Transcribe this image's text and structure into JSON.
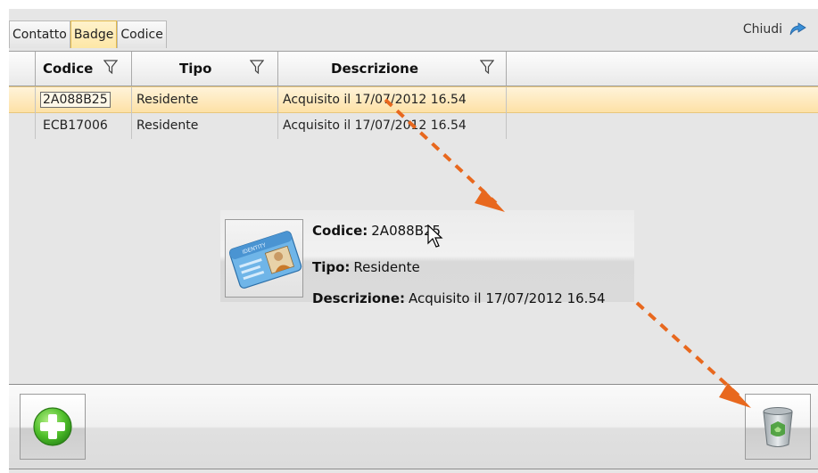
{
  "tabs": [
    "Contatto",
    "Badge",
    "Codice"
  ],
  "active_tab": "Badge",
  "close_label": "Chiudi",
  "columns": [
    {
      "label": "Codice",
      "filter_icon": "filter-icon"
    },
    {
      "label": "Tipo",
      "filter_icon": "filter-icon"
    },
    {
      "label": "Descrizione",
      "filter_icon": "filter-icon"
    }
  ],
  "rows": [
    {
      "codice": "2A088B25",
      "tipo": "Residente",
      "descrizione": "Acquisito il 17/07/2012 16.54",
      "selected": true
    },
    {
      "codice": "ECB17006",
      "tipo": "Residente",
      "descrizione": "Acquisito il 17/07/2012 16.54",
      "selected": false
    }
  ],
  "tooltip": {
    "image": "identity-card-icon",
    "codice_label": "Codice:",
    "codice_value": "2A088B25",
    "tipo_label": "Tipo:",
    "tipo_value": "Residente",
    "descrizione_label": "Descrizione:",
    "descrizione_value": "Acquisito il 17/07/2012 16.54"
  },
  "toolbar": {
    "add_icon": "add-icon",
    "delete_icon": "trash-icon"
  },
  "colors": {
    "arrow": "#e8681e",
    "selected_row": "#fde1a6",
    "active_tab_border": "#e2b94a"
  }
}
